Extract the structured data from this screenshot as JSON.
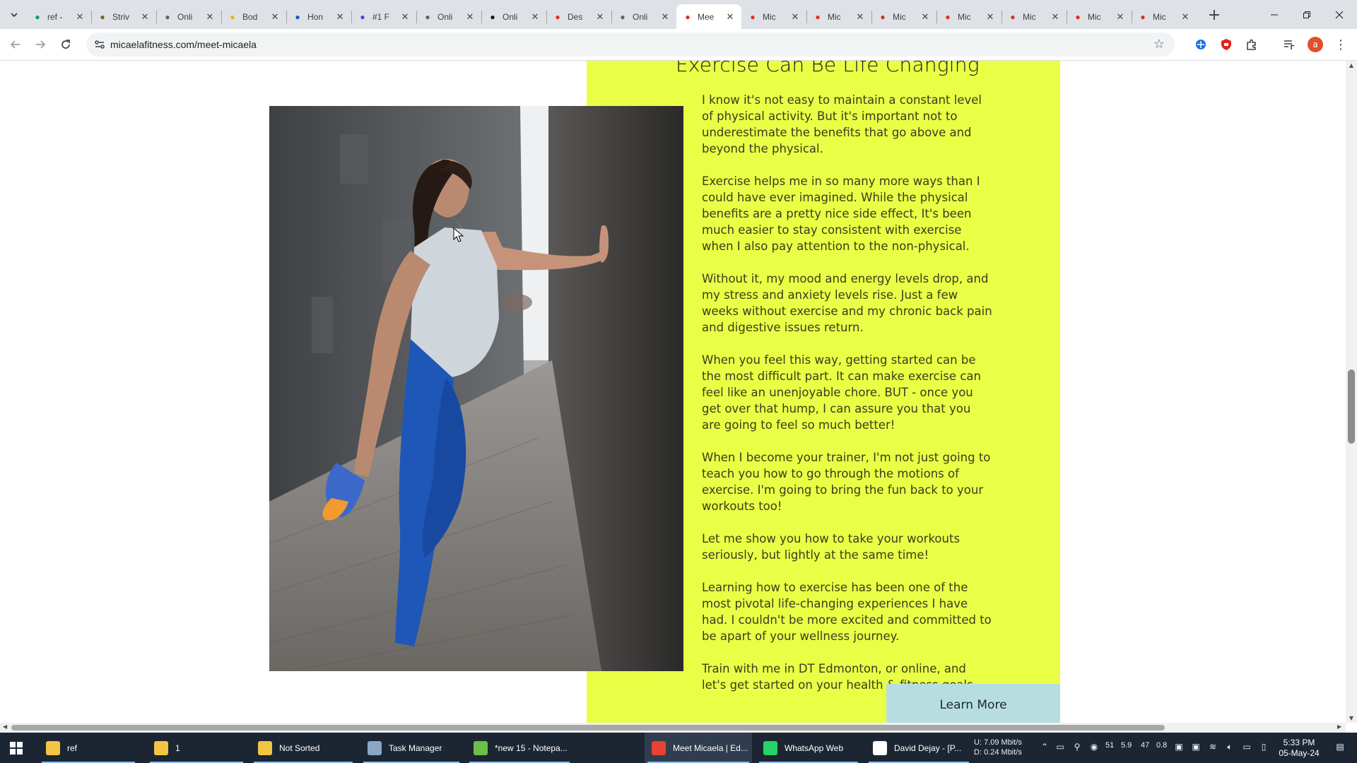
{
  "browser": {
    "tabs": [
      {
        "title": "ref -",
        "icon": "sheets-icon",
        "color": "#0f9d58"
      },
      {
        "title": "Striv",
        "icon": "strive-icon",
        "color": "#7a5b2c"
      },
      {
        "title": "Onli",
        "icon": "check-icon",
        "color": "#5f6368"
      },
      {
        "title": "Bod",
        "icon": "emoji-icon",
        "color": "#f4b400"
      },
      {
        "title": "Hon",
        "icon": "stack-icon",
        "color": "#1a56c9"
      },
      {
        "title": "#1 F",
        "icon": "shield-icon",
        "color": "#5b3fd6"
      },
      {
        "title": "Onli",
        "icon": "globe-icon",
        "color": "#5f6368"
      },
      {
        "title": "Onli",
        "icon": "k-icon",
        "color": "#111111"
      },
      {
        "title": "Des",
        "icon": "refresh-icon",
        "color": "#d93025"
      },
      {
        "title": "Onli",
        "icon": "runner-icon",
        "color": "#5f6368"
      },
      {
        "title": "Mee",
        "icon": "micaela-icon",
        "color": "#d93025",
        "active": true
      },
      {
        "title": "Mic",
        "icon": "micaela-icon",
        "color": "#d93025"
      },
      {
        "title": "Mic",
        "icon": "micaela-icon",
        "color": "#d93025"
      },
      {
        "title": "Mic",
        "icon": "micaela-icon",
        "color": "#d93025"
      },
      {
        "title": "Mic",
        "icon": "micaela-icon",
        "color": "#d93025"
      },
      {
        "title": "Mic",
        "icon": "micaela-icon",
        "color": "#d93025"
      },
      {
        "title": "Mic",
        "icon": "micaela-icon",
        "color": "#d93025"
      },
      {
        "title": "Mic",
        "icon": "micaela-icon",
        "color": "#d93025"
      }
    ],
    "url": "micaelafitness.com/meet-micaela",
    "profile_initial": "a"
  },
  "page": {
    "heading": "Exercise Can Be Life Changing",
    "paragraphs": [
      "I know it's not easy to maintain a constant level of physical activity. But it's important not to underestimate the benefits that go above and beyond the physical.",
      "Exercise helps me in so many more ways than I could have ever imagined. While the physical benefits are a pretty nice side effect, It's been much easier to stay consistent with exercise when I also pay attention to the non-physical.",
      "Without it, my mood and energy levels drop, and my stress and anxiety levels rise. Just a few weeks without exercise and my chronic back pain and digestive issues return.",
      "When you feel this way, getting started can be the most difficult part. It can make exercise can feel like an unenjoyable chore. BUT - once you get over that hump, I can assure you that you are going to feel so much better!",
      "When I become your trainer, I'm not just going to teach you how to go through the motions of exercise. I'm going to bring the fun back to your workouts too!",
      "Let me show you how to take your workouts seriously, but lightly at the same time!",
      "Learning how to exercise has been one of the most pivotal life-changing experiences I have had. I couldn't be more excited and committed to be apart of your wellness journey.",
      "Train with me in DT Edmonton, or online, and let's get started on your health & fitness goals."
    ],
    "cta_label": "Learn More",
    "accent_color": "#e9ff45",
    "cta_color": "#b8dde0"
  },
  "taskbar": {
    "items": [
      {
        "label": "ref",
        "icon": "folder-icon"
      },
      {
        "label": "1",
        "icon": "folder-icon"
      },
      {
        "label": "Not Sorted",
        "icon": "folder-icon"
      },
      {
        "label": "Task Manager",
        "icon": "task-manager-icon"
      },
      {
        "label": "*new 15 - Notepa...",
        "icon": "notepad-plus-icon"
      },
      {
        "label": "Meet Micaela | Ed...",
        "icon": "chrome-icon",
        "active": true
      },
      {
        "label": "WhatsApp Web",
        "icon": "whatsapp-icon"
      },
      {
        "label": "David Dejay - [P...",
        "icon": "browser-icon"
      }
    ],
    "net": {
      "up_label": "U:",
      "down_label": "D:",
      "up": "7.09 Mbit/s",
      "down": "0.24 Mbit/s"
    },
    "tray_numbers": [
      "51",
      "5.9",
      "47",
      "0.8"
    ],
    "time": "5:33 PM",
    "date": "05-May-24"
  }
}
